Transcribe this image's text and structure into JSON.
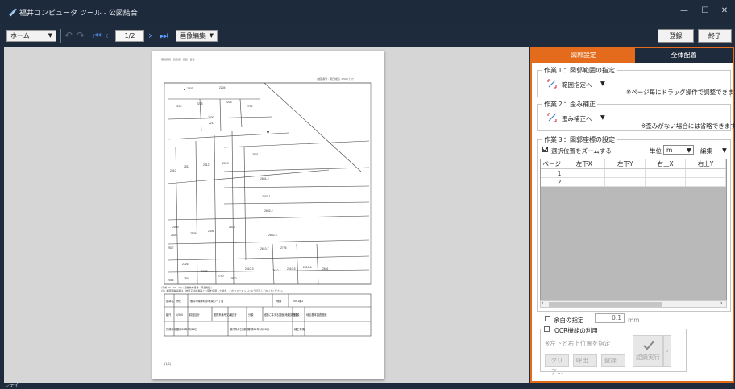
{
  "window": {
    "title": "福井コンピュータ ツール - 公図結合",
    "minimize": "—",
    "maximize": "☐",
    "close": "✕"
  },
  "toolbar": {
    "home": "ホーム",
    "page": "1/2",
    "image_edit": "画像編集",
    "register": "登録",
    "exit": "終了"
  },
  "panel": {
    "tabs": [
      "図郭設定",
      "全体配置"
    ],
    "step1": {
      "title": "作業１：図郭範囲の指定",
      "button": "範囲指定へ",
      "hint": "※ページ毎にドラッグ操作で調整できます"
    },
    "step2": {
      "title": "作業２：歪み補正",
      "button": "歪み補正へ",
      "hint": "※歪みがない場合には省略できます"
    },
    "step3": {
      "title": "作業３：図郭座標の設定",
      "zoom_check": "選択位置をズームする",
      "zoom_checked": true,
      "unit_label": "単位",
      "unit_value": "m",
      "edit": "編集",
      "columns": [
        "ページ",
        "左下X",
        "左下Y",
        "右上X",
        "右上Y"
      ],
      "rows": [
        "1",
        "2"
      ]
    },
    "margin_label": "余白の指定",
    "margin_value": "0.1",
    "margin_unit": "mm",
    "ocr_label": "OCR機能の利用",
    "ocr_hint": "※左下と右上位置を指定",
    "buttons": {
      "clear": "クリア...",
      "recall": "呼出...",
      "register": "登録...",
      "recognize": "認識実行"
    }
  },
  "status": {
    "text": "レディ"
  },
  "document": {
    "header_left": "昭和和和 . 日日日 . 日日 . 日日",
    "header_right": "(地図番号 : 南日地区)        1/500  ﾋﾟｯﾁ",
    "lots": [
      "2203",
      "2204",
      "2202",
      "2206",
      "2205",
      "2750",
      "2700",
      "2211",
      "2601-1",
      "2510",
      "2511",
      "2512",
      "2513",
      "2601-2",
      "2602-1",
      "2602-2",
      "2503",
      "2504",
      "2505",
      "2506",
      "2603",
      "2602-3",
      "2507",
      "2610-7",
      "2725",
      "2726",
      "2610-3",
      "2610-4",
      "2610-5",
      "2610-6",
      "2601",
      "2514",
      "2501",
      "2740",
      "2520",
      "2508"
    ],
    "footnote1": "(平成 00 . 00 . 00)    (自動作成番号 : 南日地区)",
    "footnote2": "(注)  本図面等情報は、地目又は地番等と公図を使用した場合、このフォーマットにより訂正しておいてください。",
    "table": {
      "r1": [
        "図郭名",
        "所在",
        "坂井市南条町字和泉町一丁目",
        "地番",
        "2001番2"
      ],
      "r2": [
        "縮尺",
        "1/500",
        "精度区分",
        "座標系番号又は記号",
        "VI",
        "分類",
        "地図に準ずる図面(地籍調査)",
        "種類",
        "地区基本調査図面"
      ],
      "r3": [
        "作成年月日",
        "平成22年3月28日",
        "備付年月日(原図)",
        "平成22年3月28日",
        "補正事項"
      ]
    },
    "page_footer": "(1/1)"
  }
}
